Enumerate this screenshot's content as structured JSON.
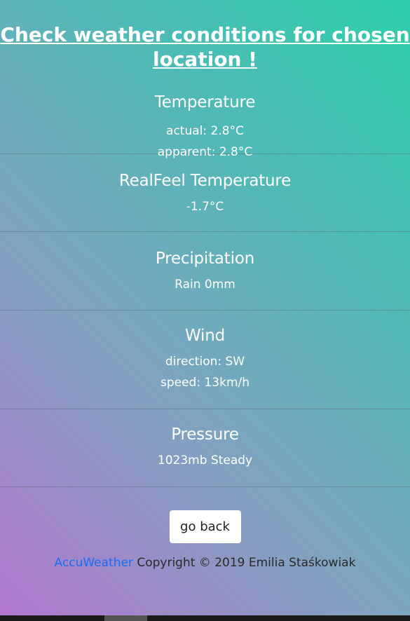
{
  "page": {
    "title_line1": "Check weather conditions for chosen",
    "title_line2": "location !"
  },
  "temperature": {
    "heading": "Temperature",
    "actual": "actual: 2.8°C",
    "apparent": "apparent: 2.8°C"
  },
  "realfeel": {
    "heading": "RealFeel Temperature",
    "value": "-1.7°C"
  },
  "precipitation": {
    "heading": "Precipitation",
    "value": "Rain 0mm"
  },
  "wind": {
    "heading": "Wind",
    "direction": "direction: SW",
    "speed": "speed: 13km/h"
  },
  "pressure": {
    "heading": "Pressure",
    "value": "1023mb Steady"
  },
  "actions": {
    "back_label": "go back"
  },
  "footer": {
    "link_text": "AccuWeather",
    "copyright": " Copyright © 2019 Emilia Staśkowiak"
  }
}
